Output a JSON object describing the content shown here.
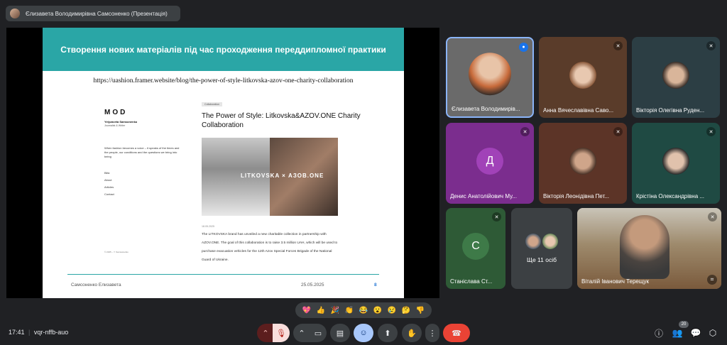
{
  "presentation_chip": {
    "title": "Єлизавета Володимирівна Самсоненко (Презентація)"
  },
  "slide": {
    "heading": "Створення нових матеріалів під час проходження переддипломної практики",
    "url": "https://uashion.framer.website/blog/the-power-of-style-litkovska-azov-one-charity-collaboration",
    "site_logo": "MOD",
    "author_name": "Yelyzaveta Samsonenko",
    "author_role": "Journalist & Writer",
    "blurb": "When fashion becomes a voice – it speaks of the times and the people, our conditions and the questions we bring into being",
    "nav": [
      "Blitz",
      "About",
      "Articles",
      "Contact"
    ],
    "copyright": "© 2025 – Y. Samsonenko",
    "tag": "Collaboration",
    "post_title": "The Power of Style: Litkovska&AZOV.ONE Charity Collaboration",
    "hero_brand": "LITKOVSKA × АЗОВ.ONE",
    "post_date": "18.05.2025",
    "post_body": "The LITKOVSKA brand has unveiled a new charitable collection in partnership with AZOV.ONE. The goal of this collaboration is to raise 3.5 million UAH, which will be used to purchase evacuation vehicles for the 12th Azov Special Forces Brigade of the National Guard of Ukraine.",
    "footer_name": "Самсоненко Елизавета",
    "footer_date": "25.05.2025",
    "footer_page": "8"
  },
  "participants": [
    {
      "name": "Єлизавета Володимирів...",
      "mic": "speaking",
      "color": "#3b3b3b"
    },
    {
      "name": "Анна Вячеславівна Саво...",
      "mic": "muted",
      "color": "#5a3c2a"
    },
    {
      "name": "Вікторія Олегівна Руден...",
      "mic": "muted",
      "color": "#2c3e44"
    },
    {
      "name": "Денис Анатолійович Му...",
      "mic": "muted",
      "color": "#7b2d8e",
      "letter": "Д"
    },
    {
      "name": "Вікторія Леонідівна Пет...",
      "mic": "muted",
      "color": "#5c3427"
    },
    {
      "name": "Крістіна Олександрівна ...",
      "mic": "muted",
      "color": "#1f4a43"
    },
    {
      "name": "Станіслава Ст...",
      "mic": "muted",
      "color": "#2e5a36",
      "letter": "С"
    },
    {
      "name": "Ще 11 осіб",
      "mic": "none",
      "color": "#3c4043"
    },
    {
      "name": "Віталій Іванович Терещук",
      "mic": "muted",
      "color": "#8a7a62"
    }
  ],
  "reactions": [
    "💖",
    "👍",
    "🎉",
    "👏",
    "😂",
    "😮",
    "😢",
    "🤔",
    "👎"
  ],
  "bottom": {
    "time": "17:41",
    "meeting_code": "vqr-nffb-auo",
    "participants_count": "20"
  },
  "colors": {
    "accent_teal": "#2aa6a6",
    "end_call": "#ea4335",
    "bg": "#202124"
  }
}
